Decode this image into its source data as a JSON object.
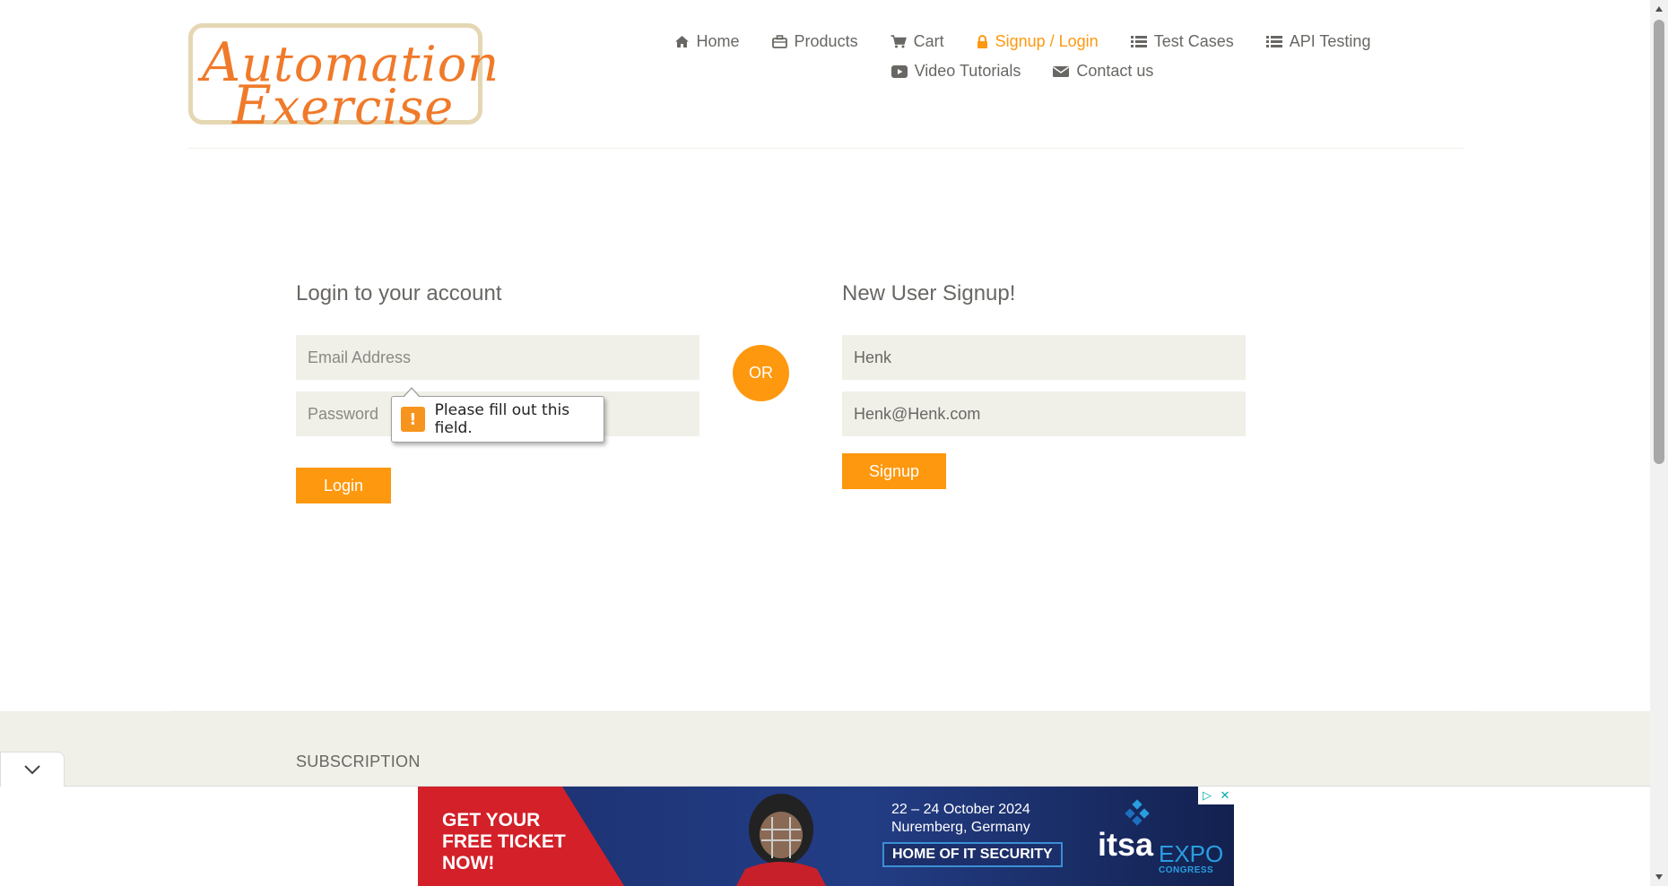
{
  "header": {
    "logo": {
      "line1_first": "A",
      "line1_rest": "utomation",
      "line2_first": "E",
      "line2_rest": "xercise"
    },
    "nav": [
      {
        "label": "Home",
        "icon": "home-icon"
      },
      {
        "label": "Products",
        "icon": "briefcase-icon"
      },
      {
        "label": "Cart",
        "icon": "cart-icon"
      },
      {
        "label": "Signup / Login",
        "icon": "lock-icon",
        "active": true
      },
      {
        "label": "Test Cases",
        "icon": "list-icon"
      },
      {
        "label": "API Testing",
        "icon": "list-icon"
      },
      {
        "label": "Video Tutorials",
        "icon": "youtube-play-icon"
      },
      {
        "label": "Contact us",
        "icon": "envelope-icon"
      }
    ]
  },
  "login": {
    "title": "Login to your account",
    "email_placeholder": "Email Address",
    "password_placeholder": "Password",
    "button": "Login",
    "validation_message": "Please fill out this field.",
    "validation_icon": "!"
  },
  "or_label": "OR",
  "signup": {
    "title": "New User Signup!",
    "name_value": "Henk",
    "email_value": "Henk@Henk.com",
    "button": "Signup"
  },
  "footer": {
    "subscription_title": "SUBSCRIPTION"
  },
  "ad": {
    "cta": "GET YOUR\nFREE TICKET\nNOW!",
    "date": "22 – 24 October 2024",
    "location": "Nuremberg, Germany",
    "tagline": "HOME OF IT SECURITY",
    "brand_it": "it",
    "brand_sa": "sa",
    "brand_expo": "EXPO",
    "brand_congress": "CONGRESS"
  },
  "colors": {
    "accent": "#fe980f",
    "text": "#696763",
    "field_bg": "#f0f0e9"
  }
}
